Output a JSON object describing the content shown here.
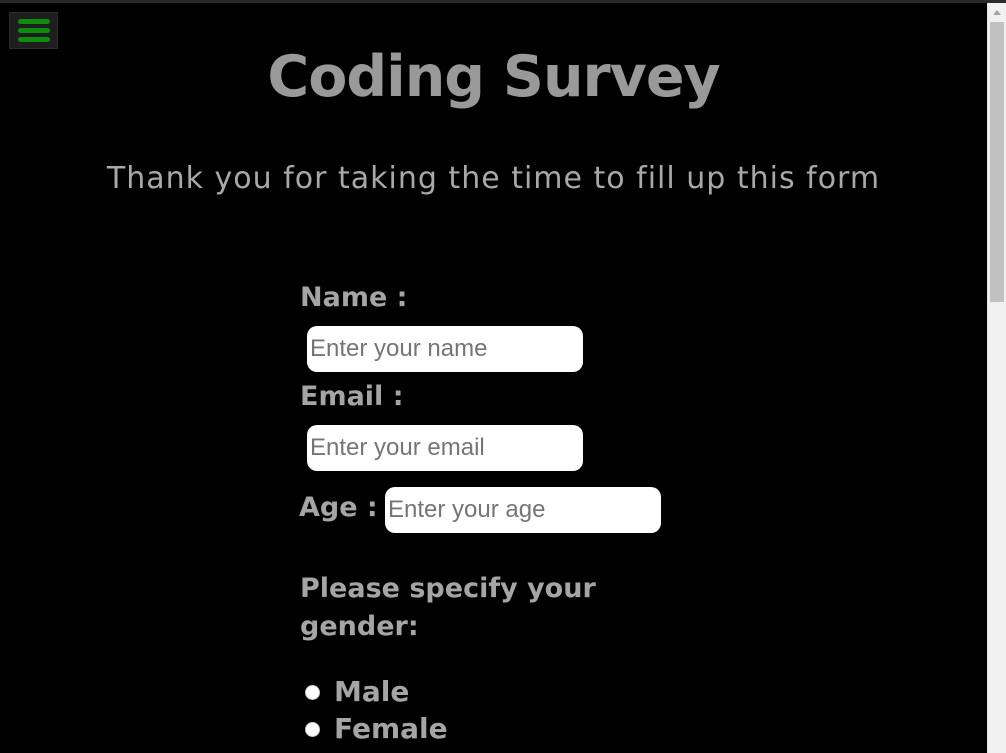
{
  "header": {
    "menu_icon": "hamburger-menu-icon",
    "menu_color": "#0d8d0d",
    "title": "Coding Survey",
    "subtitle": "Thank you for taking the time to fill up this form"
  },
  "form": {
    "name": {
      "label": "Name :",
      "placeholder": "Enter your name",
      "value": ""
    },
    "email": {
      "label": "Email :",
      "placeholder": "Enter your email",
      "value": ""
    },
    "age": {
      "label": "Age :",
      "placeholder": "Enter your age",
      "value": ""
    },
    "gender": {
      "question_line1": "Please specify your",
      "question_line2": "gender:",
      "options": [
        {
          "label": "Male",
          "selected": false
        },
        {
          "label": "Female",
          "selected": false
        }
      ]
    }
  },
  "theme": {
    "background": "#000000",
    "text": "#9a9a9a",
    "input_background": "#ffffff"
  }
}
